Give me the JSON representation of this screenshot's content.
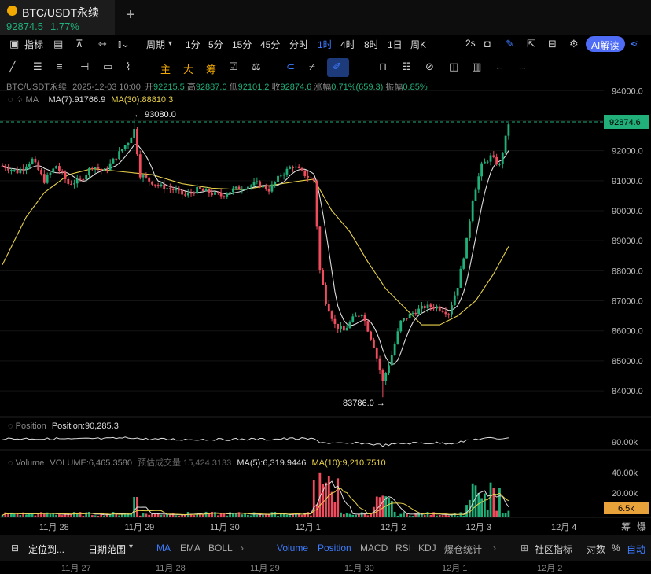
{
  "tab": {
    "symbol": "BTC/USDT永续",
    "price": "92874.5",
    "change": "1.77%"
  },
  "toolbar": {
    "indicator": "指标",
    "period": "周期",
    "intervals": [
      "1分",
      "5分",
      "15分",
      "45分",
      "分时",
      "1时",
      "4时",
      "8时",
      "1日",
      "周K"
    ],
    "selected_interval": "1时",
    "refresh": "2s",
    "ai_label": "AI解读"
  },
  "drawing_tools": [
    "主",
    "大",
    "筹"
  ],
  "info": {
    "symbol": "BTC/USDT永续",
    "datetime": "2025-12-03 10:00",
    "open_label": "开",
    "open": "92215.5",
    "high_label": "高",
    "high": "92887.0",
    "low_label": "低",
    "low": "92101.2",
    "close_label": "收",
    "close": "92874.6",
    "chg_label": "涨幅",
    "chg": "0.71%(659.3)",
    "amp_label": "振幅",
    "amp": "0.85%"
  },
  "ma_legend": {
    "name": "MA",
    "ma7": "MA(7):91766.9",
    "ma30": "MA(30):88810.3"
  },
  "annotations": {
    "high": "← 93080.0",
    "low": "83786.0 →",
    "last_price": "92874.6"
  },
  "position_legend": {
    "name": "Position",
    "value": "Position:90,285.3",
    "axis_label": "90.00k"
  },
  "volume_legend": {
    "name": "Volume",
    "vol": "VOLUME:6,465.3580",
    "est": "预估成交量:15,424.3133",
    "ma5": "MA(5):6,319.9446",
    "ma10": "MA(10):9,210.7510",
    "last_label": "6.5k"
  },
  "volume_axis": [
    "40.00k",
    "20.00k"
  ],
  "time_axis": [
    "11月 28",
    "11月 29",
    "11月 30",
    "12月 1",
    "12月 2",
    "12月 3",
    "12月 4"
  ],
  "time_axis_corner": [
    "筹",
    "爆"
  ],
  "bottom": {
    "locate": "定位到...",
    "date_range": "日期范围",
    "indicators": [
      "MA",
      "EMA",
      "BOLL"
    ],
    "sub_indicators": [
      "Volume",
      "Position",
      "MACD",
      "RSI",
      "KDJ",
      "爆仓统计"
    ],
    "community": "社区指标",
    "log": "对数",
    "percent": "%",
    "auto": "自动",
    "nav_dates": [
      "11月 27",
      "11月 28",
      "11月 29",
      "11月 30",
      "12月 1",
      "12月 2"
    ]
  },
  "colors": {
    "up": "#21b07a",
    "down": "#ef4d5e",
    "ma7": "#dddddd",
    "ma30": "#e8d24a",
    "accent": "#3d7bff"
  },
  "chart_data": {
    "type": "candlestick",
    "ylim": [
      83400,
      94400
    ],
    "y_ticks": [
      94000,
      93000,
      92000,
      91000,
      90000,
      89000,
      88000,
      87000,
      86000,
      85000,
      84000
    ],
    "waypoints": [
      [
        0,
        91500
      ],
      [
        5,
        91300
      ],
      [
        10,
        91700
      ],
      [
        14,
        91000
      ],
      [
        18,
        91500
      ],
      [
        22,
        90900
      ],
      [
        26,
        91000
      ],
      [
        30,
        91500
      ],
      [
        34,
        91300
      ],
      [
        38,
        91800
      ],
      [
        42,
        92300
      ],
      [
        44,
        92700
      ],
      [
        46,
        91200
      ],
      [
        49,
        91000
      ],
      [
        53,
        90800
      ],
      [
        57,
        90700
      ],
      [
        61,
        90500
      ],
      [
        65,
        90700
      ],
      [
        69,
        90600
      ],
      [
        73,
        90500
      ],
      [
        77,
        90700
      ],
      [
        81,
        90800
      ],
      [
        85,
        90900
      ],
      [
        89,
        90700
      ],
      [
        93,
        91200
      ],
      [
        97,
        91500
      ],
      [
        101,
        91200
      ],
      [
        104,
        91000
      ],
      [
        106,
        88000
      ],
      [
        108,
        87000
      ],
      [
        111,
        86200
      ],
      [
        114,
        86000
      ],
      [
        117,
        86400
      ],
      [
        120,
        86600
      ],
      [
        124,
        85500
      ],
      [
        127,
        84300
      ],
      [
        130,
        85200
      ],
      [
        133,
        86300
      ],
      [
        137,
        86600
      ],
      [
        141,
        86800
      ],
      [
        145,
        86800
      ],
      [
        149,
        86600
      ],
      [
        152,
        87500
      ],
      [
        155,
        89000
      ],
      [
        157,
        90400
      ],
      [
        160,
        91500
      ],
      [
        163,
        91800
      ],
      [
        166,
        91500
      ],
      [
        169,
        92874.6
      ]
    ],
    "ma30_waypoints": [
      [
        0,
        88200
      ],
      [
        8,
        89800
      ],
      [
        14,
        90600
      ],
      [
        22,
        91200
      ],
      [
        30,
        91400
      ],
      [
        40,
        91300
      ],
      [
        50,
        91200
      ],
      [
        60,
        90900
      ],
      [
        70,
        90750
      ],
      [
        80,
        90700
      ],
      [
        90,
        90850
      ],
      [
        100,
        91000
      ],
      [
        104,
        91050
      ],
      [
        110,
        90000
      ],
      [
        116,
        89300
      ],
      [
        122,
        88300
      ],
      [
        128,
        87400
      ],
      [
        134,
        86800
      ],
      [
        140,
        86200
      ],
      [
        146,
        86200
      ],
      [
        152,
        86500
      ],
      [
        158,
        87000
      ],
      [
        164,
        87900
      ],
      [
        169,
        88810
      ]
    ],
    "candle_count": 170,
    "position": {
      "label": "Position",
      "last": 90285.3
    },
    "volume": {
      "last": 6465.358,
      "ma5": 6319.9446,
      "ma10": 9210.751
    }
  }
}
